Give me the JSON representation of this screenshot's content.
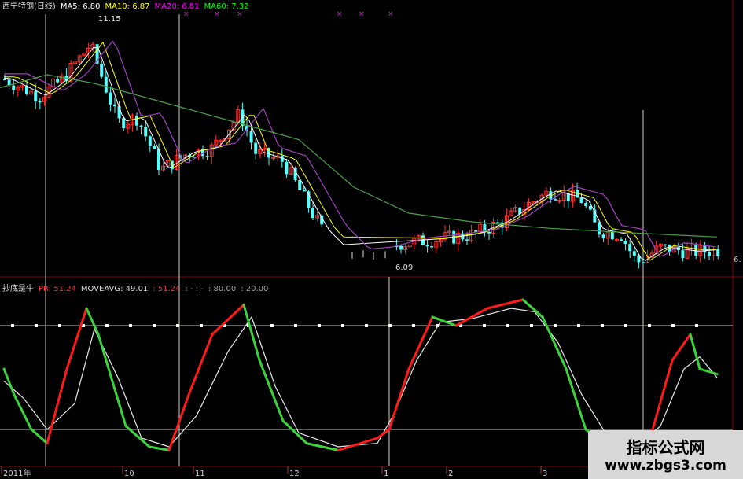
{
  "top_panel": {
    "stock_name": "西宁特钢(日线)",
    "ma5": "MA5: 6.80",
    "ma10": "MA10: 6.87",
    "ma20": "MA20: 6.81",
    "ma60": "MA60: 7.32",
    "price_high_label": "11.15",
    "price_low_label": "6.09",
    "right_edge_label": "6."
  },
  "bottom_panel": {
    "name": "抄底是牛",
    "pr": "PR: 51.24",
    "moveavg": "MOVEAVG: 49.01",
    "dup_value": ": 51.24",
    "dots": ": - : -",
    "ref_80": ": 80.00",
    "ref_20": ": 20.00"
  },
  "date_axis": [
    "2011年",
    "10",
    "11",
    "12",
    "1",
    "2",
    "3"
  ],
  "watermark": {
    "title": "指标公式网",
    "url": "www.zbgs3.com"
  },
  "colors": {
    "up": "#ff3232",
    "down": "#54ffff",
    "ma5": "#ffffff",
    "ma10": "#ffff00",
    "ma20": "#ff00ff",
    "ma60": "#00ff00",
    "ma20_line": "#a040c0",
    "ma60_line": "#4aa04a",
    "pr_up": "#ff1a1a",
    "pr_down": "#3cd23c",
    "moveavg": "#e8e8e8",
    "grid": "#8b0000",
    "vline": "#d0d0c0"
  },
  "chart_data": [
    {
      "type": "candlestick",
      "title": "西宁特钢(日线)",
      "series": [
        {
          "name": "MA5",
          "value": 6.8
        },
        {
          "name": "MA10",
          "value": 6.87
        },
        {
          "name": "MA20",
          "value": 6.81
        },
        {
          "name": "MA60",
          "value": 7.32
        }
      ],
      "annotations": [
        {
          "label": "11.15",
          "note": "period high"
        },
        {
          "label": "6.09",
          "note": "period low"
        }
      ],
      "x_ticks": [
        "2011年",
        "10",
        "11",
        "12",
        "1",
        "2",
        "3"
      ],
      "ylim": [
        5.9,
        11.4
      ]
    },
    {
      "type": "line",
      "title": "抄底是牛",
      "series": [
        {
          "name": "PR",
          "last": 51.24
        },
        {
          "name": "MOVEAVG",
          "last": 49.01
        }
      ],
      "reference_lines": [
        80,
        20
      ],
      "ylim": [
        0,
        100
      ]
    }
  ]
}
